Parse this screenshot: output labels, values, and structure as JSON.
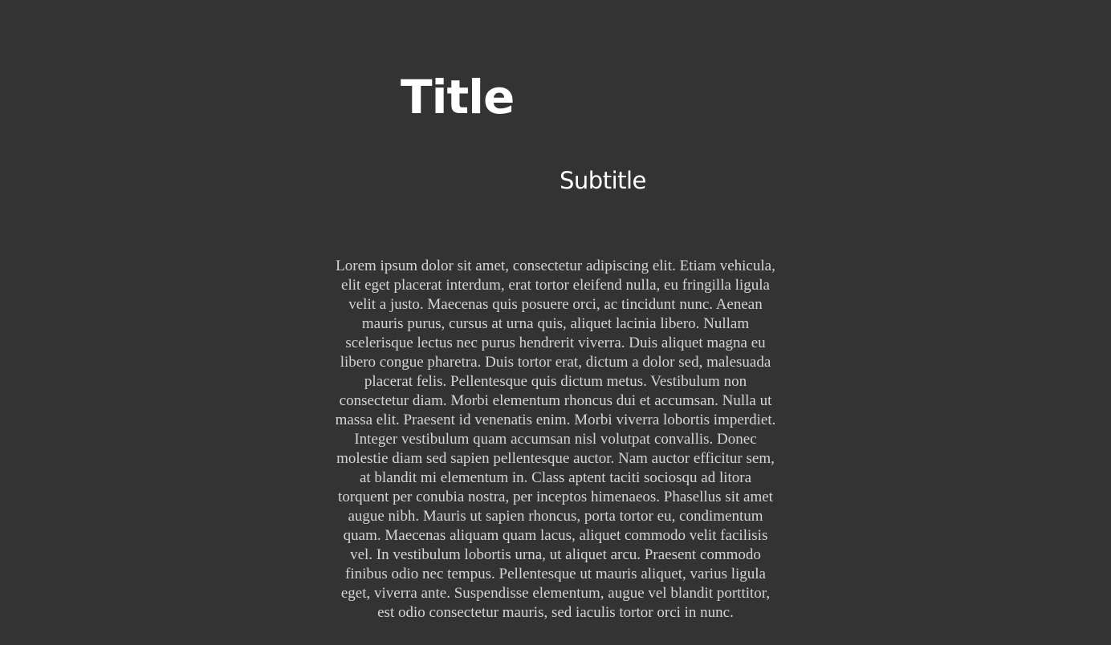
{
  "page": {
    "title": "Title",
    "subtitle": "Subtitle",
    "body": "Lorem ipsum dolor sit amet, consectetur adipiscing elit. Etiam vehicula, elit eget placerat interdum, erat tortor eleifend nulla, eu fringilla ligula velit a justo. Maecenas quis posuere orci, ac tincidunt nunc. Aenean mauris purus, cursus at urna quis, aliquet lacinia libero. Nullam scelerisque lectus nec purus hendrerit viverra. Duis aliquet magna eu libero congue pharetra. Duis tortor erat, dictum a dolor sed, malesuada placerat felis. Pellentesque quis dictum metus. Vestibulum non consectetur diam. Morbi elementum rhoncus dui et accumsan. Nulla ut massa elit. Praesent id venenatis enim. Morbi viverra lobortis imperdiet. Integer vestibulum quam accumsan nisl volutpat convallis. Donec molestie diam sed sapien pellentesque auctor. Nam auctor efficitur sem, at blandit mi elementum in. Class aptent taciti sociosqu ad litora torquent per conubia nostra, per inceptos himenaeos. Phasellus sit amet augue nibh. Mauris ut sapien rhoncus, porta tortor eu, condimentum quam. Maecenas aliquam quam lacus, aliquet commodo velit facilisis vel. In vestibulum lobortis urna, ut aliquet arcu. Praesent commodo finibus odio nec tempus. Pellentesque ut mauris aliquet, varius ligula eget, viverra ante. Suspendisse elementum, augue vel blandit porttitor, est odio consectetur mauris, sed iaculis tortor orci in nunc."
  },
  "colors": {
    "background": "#333333",
    "heading": "#ffffff",
    "body_text": "#d4d4d4"
  }
}
